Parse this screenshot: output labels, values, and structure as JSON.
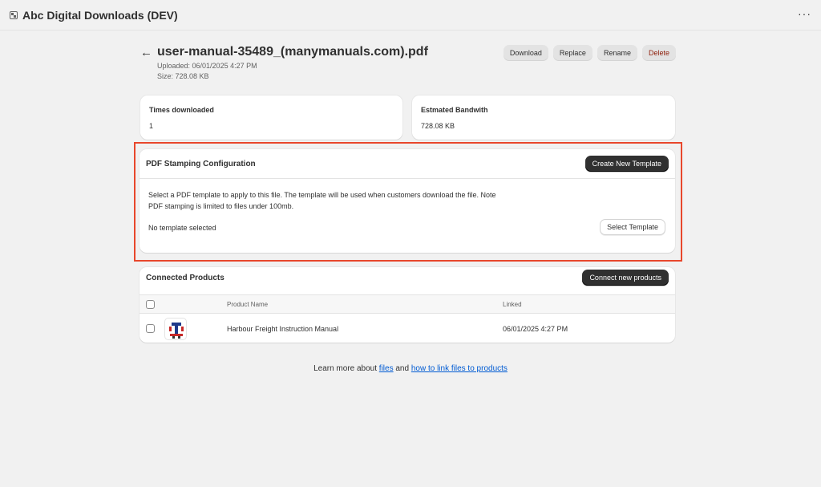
{
  "app": {
    "title": "Abc Digital Downloads (DEV)",
    "more_label": "···"
  },
  "file": {
    "name": "user-manual-35489_(manymanuals.com).pdf",
    "uploaded": "Uploaded: 06/01/2025 4:27 PM",
    "size": "Size: 728.08 KB"
  },
  "actions": {
    "download": "Download",
    "replace": "Replace",
    "rename": "Rename",
    "delete": "Delete"
  },
  "stats": {
    "times_downloaded": {
      "label": "Times downloaded",
      "value": "1"
    },
    "bandwidth": {
      "label": "Estmated Bandwith",
      "value": "728.08 KB"
    }
  },
  "pdf_stamping": {
    "title": "PDF Stamping Configuration",
    "create_button": "Create New Template",
    "description": "Select a PDF template to apply to this file. The template will be used when customers download the file. Note PDF stamping is limited to files under 100mb.",
    "status": "No template selected",
    "select_button": "Select Template"
  },
  "connected_products": {
    "title": "Connected Products",
    "connect_button": "Connect new products",
    "columns": {
      "product_name": "Product Name",
      "linked": "Linked"
    },
    "rows": [
      {
        "name": "Harbour Freight Instruction Manual",
        "linked": "06/01/2025 4:27 PM"
      }
    ]
  },
  "footer": {
    "prefix": "Learn more about ",
    "link_files": "files",
    "middle": " and ",
    "link_howto": "how to link files to products"
  },
  "colors": {
    "highlight": "#e8472c",
    "primary_button": "#303030",
    "link": "#005bd3",
    "delete_text": "#8e1f0b"
  }
}
